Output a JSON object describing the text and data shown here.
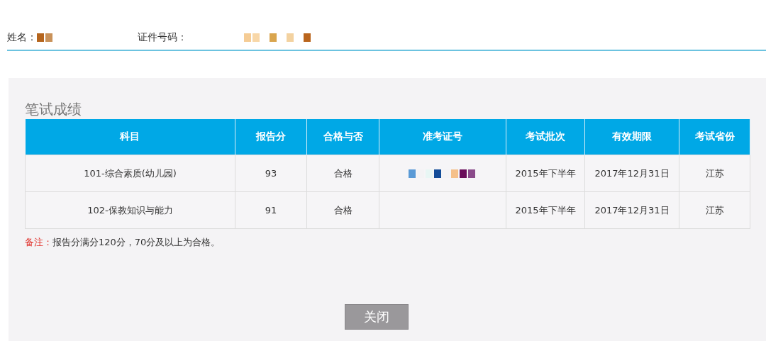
{
  "person": {
    "name_label": "姓名：",
    "name_redacted": true,
    "id_label": "证件号码：",
    "id_redacted": true
  },
  "section_title": "笔试成绩",
  "table": {
    "columns": [
      "科目",
      "报告分",
      "合格与否",
      "准考证号",
      "考试批次",
      "有效期限",
      "考试省份"
    ],
    "rows": [
      {
        "subject": "101-综合素质(幼儿园)",
        "score": "93",
        "result": "合格",
        "ticket_redacted": true,
        "batch": "2015年下半年",
        "valid_until": "2017年12月31日",
        "province": "江苏"
      },
      {
        "subject": "102-保教知识与能力",
        "score": "91",
        "result": "合格",
        "ticket_redacted": false,
        "batch": "2015年下半年",
        "valid_until": "2017年12月31日",
        "province": "江苏"
      }
    ]
  },
  "note": {
    "label": "备注：",
    "text": "报告分满分120分，70分及以上为合格。"
  },
  "close_button": "关闭"
}
